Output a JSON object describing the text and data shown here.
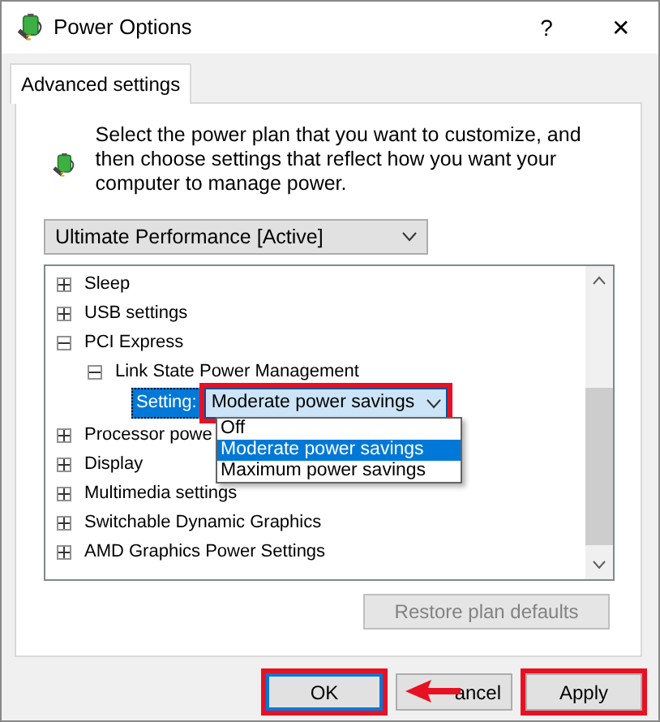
{
  "window": {
    "title": "Power Options",
    "help": "?",
    "close": "✕"
  },
  "tabs": [
    {
      "label": "Advanced settings",
      "selected": true
    }
  ],
  "description": "Select the power plan that you want to customize, and then choose settings that reflect how you want your computer to manage power.",
  "plan_select": {
    "value": "Ultimate Performance [Active]"
  },
  "tree": [
    {
      "kind": "group",
      "label": "Sleep",
      "expanded": false
    },
    {
      "kind": "group",
      "label": "USB settings",
      "expanded": false
    },
    {
      "kind": "group",
      "label": "PCI Express",
      "expanded": true,
      "children": [
        {
          "kind": "group",
          "label": "Link State Power Management",
          "expanded": true,
          "children": [
            {
              "kind": "setting",
              "label": "Setting:",
              "selected": true,
              "value": "Moderate power savings",
              "annotated": true,
              "open": true,
              "options": [
                {
                  "label": "Off",
                  "selected": false
                },
                {
                  "label": "Moderate power savings",
                  "selected": true
                },
                {
                  "label": "Maximum power savings",
                  "selected": false
                }
              ]
            }
          ]
        }
      ]
    },
    {
      "kind": "group",
      "label": "Processor powe",
      "expanded": false
    },
    {
      "kind": "group",
      "label": "Display",
      "expanded": false
    },
    {
      "kind": "group",
      "label": "Multimedia settings",
      "expanded": false
    },
    {
      "kind": "group",
      "label": "Switchable Dynamic Graphics",
      "expanded": false
    },
    {
      "kind": "group",
      "label": "AMD Graphics Power Settings",
      "expanded": false
    }
  ],
  "restore_button": {
    "label": "Restore plan defaults",
    "disabled": true
  },
  "buttons": [
    {
      "label": "OK",
      "annotated": true,
      "default": true
    },
    {
      "label": "ancel",
      "annotated": false,
      "default": false,
      "arrow": true
    },
    {
      "label": "Apply",
      "annotated": true,
      "default": false
    }
  ]
}
